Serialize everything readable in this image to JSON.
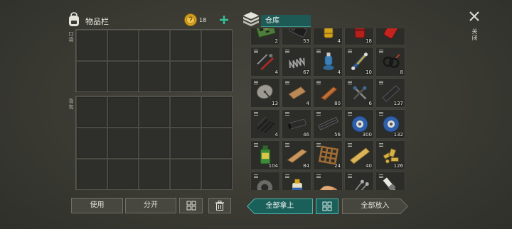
{
  "header": {
    "inventory_title": "物品栏",
    "inventory_icon": "backpack-icon",
    "coins": "18",
    "coin_icon": "coin-icon",
    "add_coins_icon": "plus-icon",
    "storage_title": "仓库",
    "storage_icon": "storage-box-icon",
    "close_label": "关闭",
    "close_icon": "close-icon"
  },
  "inventory": {
    "pocket_label": "口袋",
    "backpack_label": "背包",
    "buttons": {
      "use": "使用",
      "split": "分开",
      "sort_icon": "grid-icon",
      "discard_icon": "trash-icon"
    }
  },
  "storage": {
    "items": [
      {
        "icon": "circuit-board-icon",
        "count": 2
      },
      {
        "icon": "black-cartridge-icon",
        "count": 53
      },
      {
        "icon": "yellow-canister-icon",
        "count": 4
      },
      {
        "icon": "red-canister-icon",
        "count": 18
      },
      {
        "icon": "red-valve-icon"
      },
      {
        "icon": "tool-kit-icon",
        "count": 4
      },
      {
        "icon": "spring-icon",
        "count": 67
      },
      {
        "icon": "gas-cylinder-icon",
        "count": 4
      },
      {
        "icon": "hydraulic-piston-icon",
        "count": 10
      },
      {
        "icon": "wire-icon",
        "count": 8
      },
      {
        "icon": "satellite-dish-icon",
        "count": 13
      },
      {
        "icon": "wooden-board-icon",
        "count": 4
      },
      {
        "icon": "copper-bar-icon",
        "count": 80
      },
      {
        "icon": "scrap-tools-icon",
        "count": 6
      },
      {
        "icon": "metal-bar-icon",
        "count": 137
      },
      {
        "icon": "nails-icon",
        "count": 4
      },
      {
        "icon": "pipe-icon",
        "count": 46
      },
      {
        "icon": "rail-icon",
        "count": 56
      },
      {
        "icon": "wire-spool-icon",
        "count": 300
      },
      {
        "icon": "wire-spool-icon",
        "count": 132
      },
      {
        "icon": "oil-bottle-icon",
        "count": 104
      },
      {
        "icon": "plank-icon",
        "count": 84
      },
      {
        "icon": "wood-frame-icon",
        "count": 24
      },
      {
        "icon": "wood-beam-icon",
        "count": 40
      },
      {
        "icon": "gold-parts-icon",
        "count": 126
      },
      {
        "icon": "tire-icon"
      },
      {
        "icon": "glue-bottle-icon"
      },
      {
        "icon": "sawdust-icon"
      },
      {
        "icon": "screws-icon"
      },
      {
        "icon": "spark-plug-icon"
      }
    ]
  },
  "actions": {
    "take_all": "全部拿上",
    "sort_icon": "grid-icon",
    "put_all": "全部放入"
  },
  "colors": {
    "accent_teal": "#1d5a55",
    "accent_teal_border": "#4fb3a8",
    "plus_green": "#35c29a",
    "coin_gold": "#d9a21e",
    "panel_bg": "#3a3a33"
  }
}
